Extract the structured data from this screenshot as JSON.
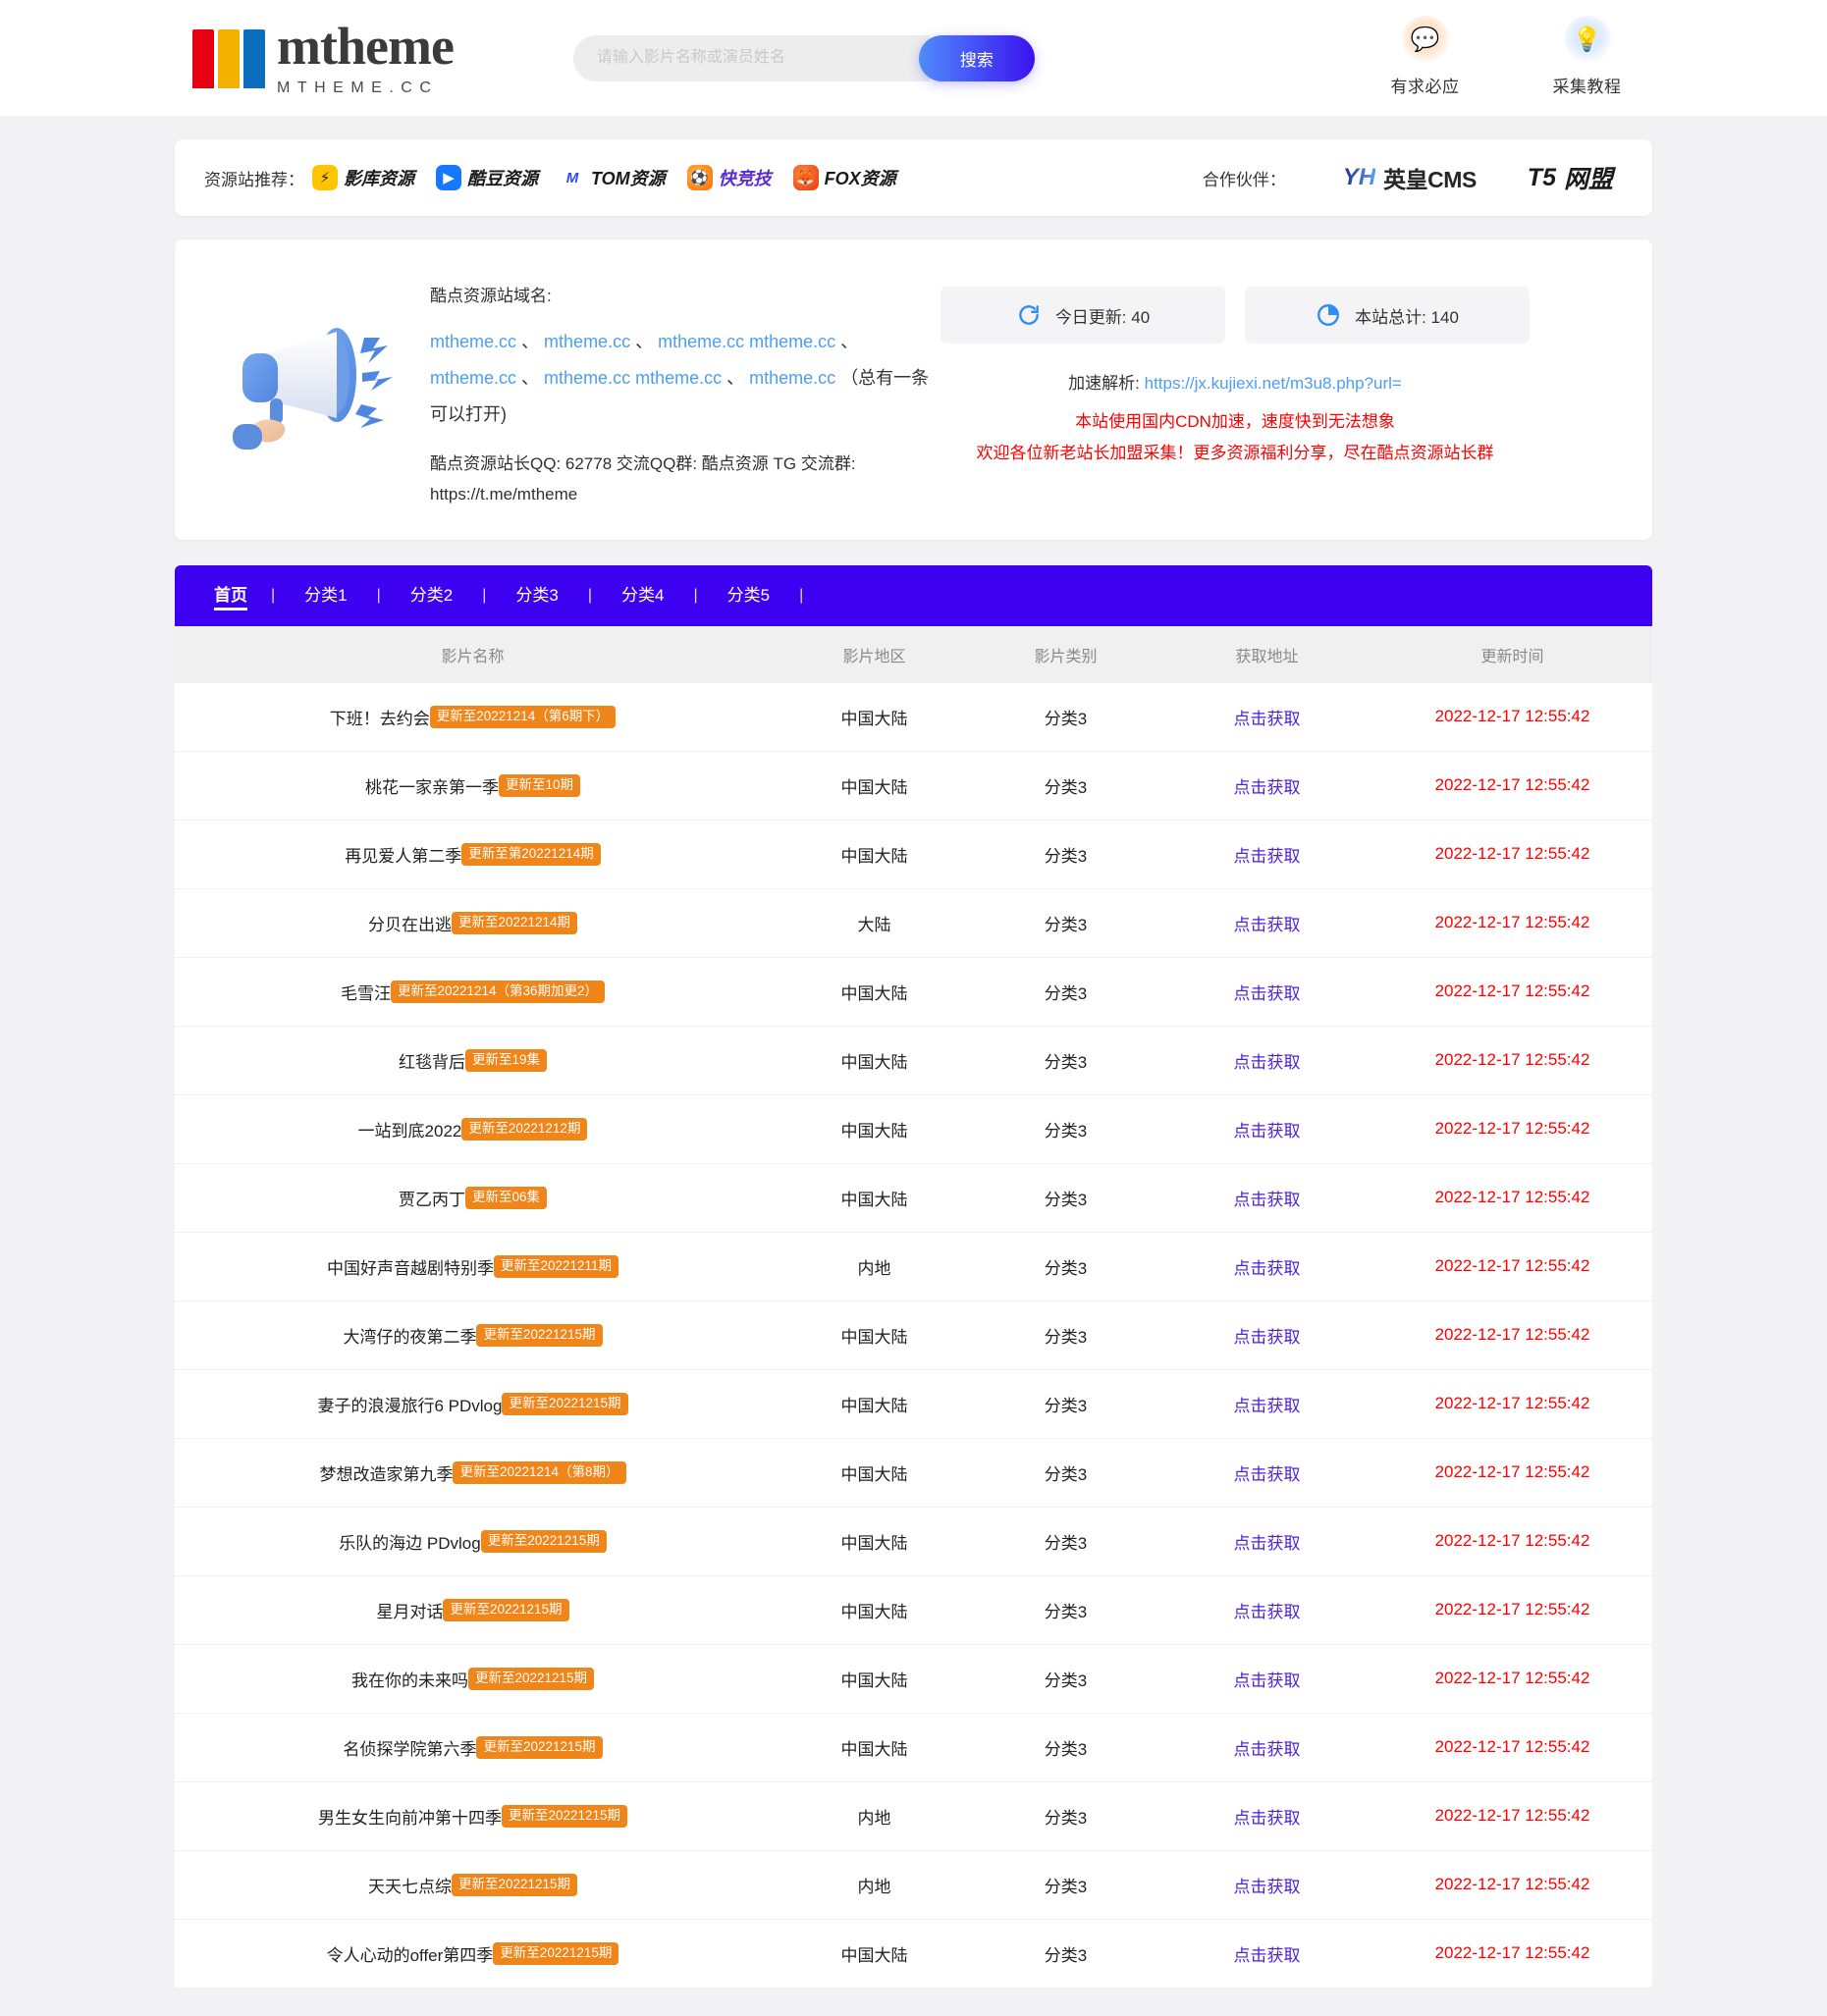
{
  "header": {
    "logo_word": "mtheme",
    "logo_sub": "MTHEME.CC",
    "search_placeholder": "请输入影片名称或演员姓名",
    "search_value": "",
    "search_button": "搜索",
    "icons": [
      {
        "name": "speech-bubble-icon",
        "glyph": "💬",
        "label": "有求必应"
      },
      {
        "name": "lightbulb-icon",
        "glyph": "💡",
        "label": "采集教程"
      }
    ]
  },
  "partners": {
    "label": "资源站推荐：",
    "items": [
      {
        "icon": "lightning-icon",
        "glyph": "⚡",
        "style": "yellow",
        "text": "影库资源"
      },
      {
        "icon": "play-icon",
        "glyph": "▶",
        "style": "blue",
        "text": "酷豆资源"
      },
      {
        "icon": "m-mark-icon",
        "glyph": "M",
        "style": "plain",
        "text": "TOM资源"
      },
      {
        "icon": "ball-icon",
        "glyph": "⚽",
        "style": "orange",
        "text": "快竞技"
      },
      {
        "icon": "fox-icon",
        "glyph": "🦊",
        "style": "fox",
        "text": "FOX资源"
      }
    ],
    "coop_label": "合作伙伴：",
    "coop": [
      {
        "mark": "YH",
        "text": "英皇CMS"
      },
      {
        "mark": "T5",
        "text": "网盟"
      }
    ]
  },
  "notice": {
    "title": "酷点资源站域名:",
    "domains": [
      "mtheme.cc",
      "mtheme.cc",
      "mtheme.cc",
      "mtheme.cc",
      "mtheme.cc",
      "mtheme.cc",
      "mtheme.cc",
      "mtheme.cc"
    ],
    "domains_note": "（总有一条可以打开)",
    "contact": "酷点资源站长QQ: 62778 交流QQ群: 酷点资源 TG 交流群: https://t.me/mtheme",
    "stats": [
      {
        "icon": "refresh-icon",
        "label": "今日更新: 40"
      },
      {
        "icon": "pie-chart-icon",
        "label": "本站总计: 140"
      }
    ],
    "parse_label": "加速解析:",
    "parse_url": "https://jx.kujiexi.net/m3u8.php?url=",
    "red_line1": "本站使用国内CDN加速，速度快到无法想象",
    "red_line2": "欢迎各位新老站长加盟采集！更多资源福利分享，尽在酷点资源站长群"
  },
  "nav": {
    "items": [
      {
        "label": "首页",
        "active": true
      },
      {
        "label": "分类1",
        "active": false
      },
      {
        "label": "分类2",
        "active": false
      },
      {
        "label": "分类3",
        "active": false
      },
      {
        "label": "分类4",
        "active": false
      },
      {
        "label": "分类5",
        "active": false
      }
    ],
    "separator": "|"
  },
  "table": {
    "columns": [
      "影片名称",
      "影片地区",
      "影片类别",
      "获取地址",
      "更新时间"
    ],
    "link_label": "点击获取",
    "rows": [
      {
        "name": "下班！去约会",
        "badge": "更新至20221214（第6期下）",
        "region": "中国大陆",
        "category": "分类3",
        "time": "2022-12-17 12:55:42"
      },
      {
        "name": "桃花一家亲第一季",
        "badge": "更新至10期",
        "region": "中国大陆",
        "category": "分类3",
        "time": "2022-12-17 12:55:42"
      },
      {
        "name": "再见爱人第二季",
        "badge": "更新至第20221214期",
        "region": "中国大陆",
        "category": "分类3",
        "time": "2022-12-17 12:55:42"
      },
      {
        "name": "分贝在出逃",
        "badge": "更新至20221214期",
        "region": "大陆",
        "category": "分类3",
        "time": "2022-12-17 12:55:42"
      },
      {
        "name": "毛雪汪",
        "badge": "更新至20221214（第36期加更2）",
        "region": "中国大陆",
        "category": "分类3",
        "time": "2022-12-17 12:55:42"
      },
      {
        "name": "红毯背后",
        "badge": "更新至19集",
        "region": "中国大陆",
        "category": "分类3",
        "time": "2022-12-17 12:55:42"
      },
      {
        "name": "一站到底2022",
        "badge": "更新至20221212期",
        "region": "中国大陆",
        "category": "分类3",
        "time": "2022-12-17 12:55:42"
      },
      {
        "name": "贾乙丙丁",
        "badge": "更新至06集",
        "region": "中国大陆",
        "category": "分类3",
        "time": "2022-12-17 12:55:42"
      },
      {
        "name": "中国好声音越剧特别季",
        "badge": "更新至20221211期",
        "region": "内地",
        "category": "分类3",
        "time": "2022-12-17 12:55:42"
      },
      {
        "name": "大湾仔的夜第二季",
        "badge": "更新至20221215期",
        "region": "中国大陆",
        "category": "分类3",
        "time": "2022-12-17 12:55:42"
      },
      {
        "name": "妻子的浪漫旅行6 PDvlog",
        "badge": "更新至20221215期",
        "region": "中国大陆",
        "category": "分类3",
        "time": "2022-12-17 12:55:42"
      },
      {
        "name": "梦想改造家第九季",
        "badge": "更新至20221214（第8期）",
        "region": "中国大陆",
        "category": "分类3",
        "time": "2022-12-17 12:55:42"
      },
      {
        "name": "乐队的海边 PDvlog",
        "badge": "更新至20221215期",
        "region": "中国大陆",
        "category": "分类3",
        "time": "2022-12-17 12:55:42"
      },
      {
        "name": "星月对话",
        "badge": "更新至20221215期",
        "region": "中国大陆",
        "category": "分类3",
        "time": "2022-12-17 12:55:42"
      },
      {
        "name": "我在你的未来吗",
        "badge": "更新至20221215期",
        "region": "中国大陆",
        "category": "分类3",
        "time": "2022-12-17 12:55:42"
      },
      {
        "name": "名侦探学院第六季",
        "badge": "更新至20221215期",
        "region": "中国大陆",
        "category": "分类3",
        "time": "2022-12-17 12:55:42"
      },
      {
        "name": "男生女生向前冲第十四季",
        "badge": "更新至20221215期",
        "region": "内地",
        "category": "分类3",
        "time": "2022-12-17 12:55:42"
      },
      {
        "name": "天天七点综",
        "badge": "更新至20221215期",
        "region": "内地",
        "category": "分类3",
        "time": "2022-12-17 12:55:42"
      },
      {
        "name": "令人心动的offer第四季",
        "badge": "更新至20221215期",
        "region": "中国大陆",
        "category": "分类3",
        "time": "2022-12-17 12:55:42"
      }
    ]
  },
  "colors": {
    "nav_bg": "#3d00f0",
    "badge": "#f08519",
    "link": "#4b1fe0",
    "time": "#ff0000",
    "domain_link": "#4b9ef5"
  }
}
